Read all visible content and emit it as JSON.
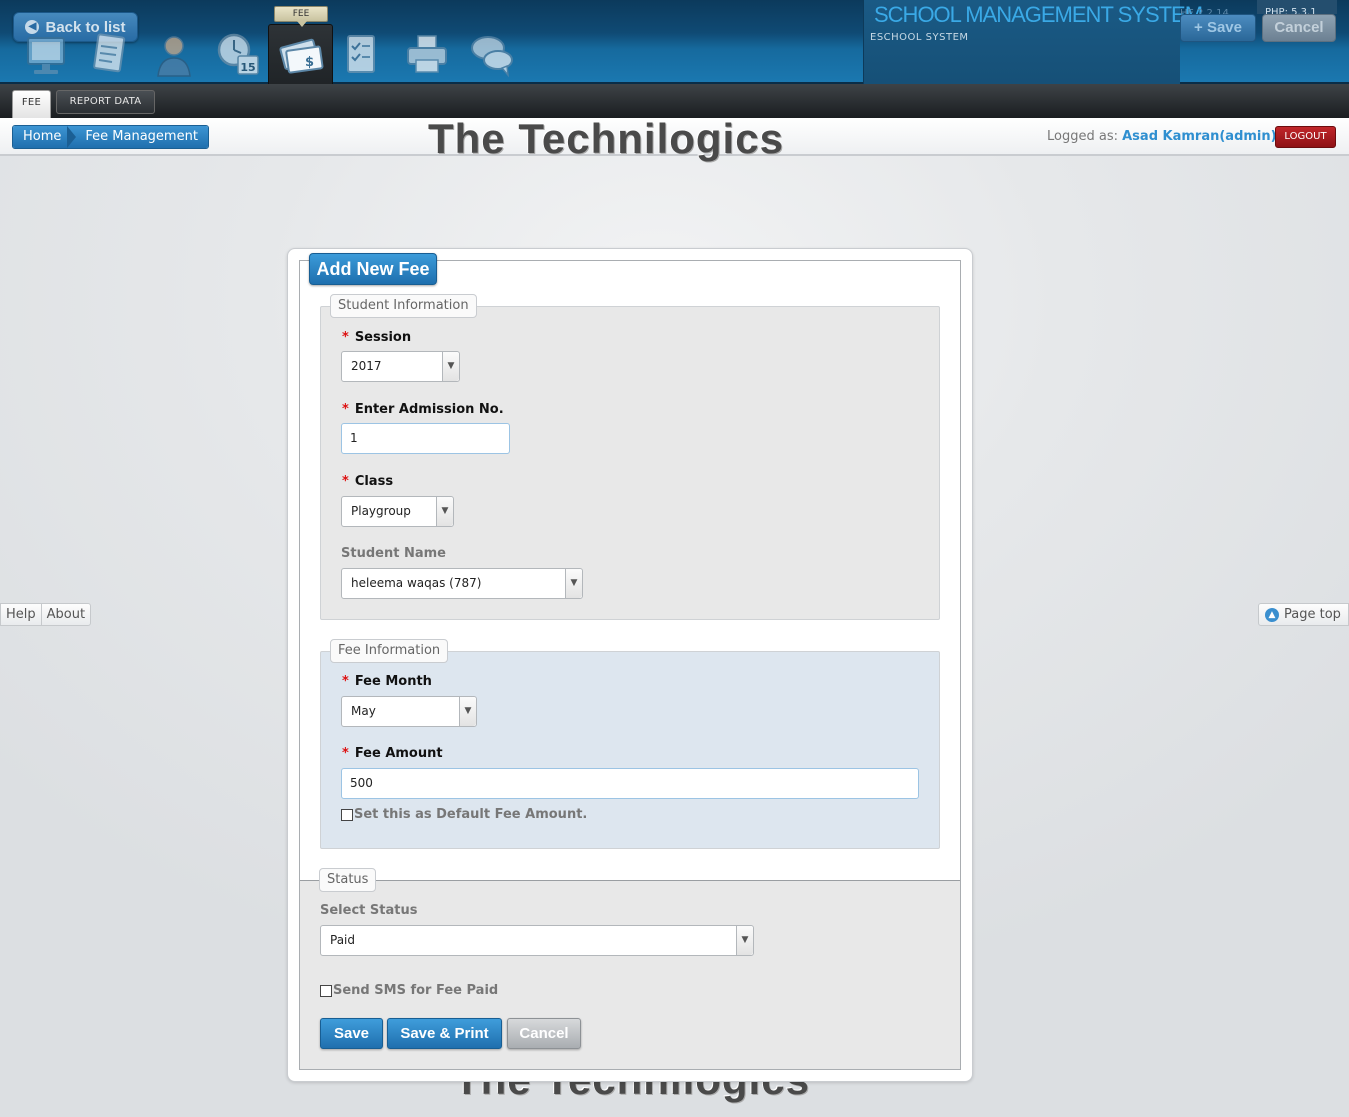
{
  "toolbar": {
    "back_label": "Back to list",
    "active_module_flag": "FEE",
    "brand_title": "SCHOOL MANAGEMENT SYSTEM",
    "brand_subtitle": "ESCHOOL SYSTEM",
    "version_text": "HE 2.2.14",
    "php_label": "PHP: 5.3.1",
    "save_label": "+ Save",
    "cancel_label": "Cancel",
    "module_icons": [
      "monitor-icon",
      "notepad-icon",
      "user-icon",
      "calendar-clock-icon",
      "fee-icon",
      "checklist-icon",
      "printer-icon",
      "chat-icon"
    ]
  },
  "tabs": [
    {
      "label": "FEE",
      "active": true
    },
    {
      "label": "REPORT DATA",
      "active": false
    }
  ],
  "breadcrumb": {
    "home": "Home",
    "current": "Fee Management"
  },
  "user": {
    "logged_prefix": "Logged as:",
    "name": "Asad Kamran(admin)",
    "logout_label": "LOGOUT"
  },
  "watermark": "The Technilogics",
  "side": {
    "help": "Help",
    "about": "About",
    "page_top": "Page top"
  },
  "form": {
    "title": "Add New Fee",
    "student_section": {
      "legend": "Student Information",
      "session_label": "Session",
      "session_value": "2017",
      "admission_label": "Enter Admission No.",
      "admission_value": "1",
      "class_label": "Class",
      "class_value": "Playgroup",
      "student_label": "Student Name",
      "student_value": "heleema waqas (787)"
    },
    "fee_section": {
      "legend": "Fee Information",
      "month_label": "Fee Month",
      "month_value": "May",
      "amount_label": "Fee Amount",
      "amount_value": "500",
      "default_label": "Set this as Default Fee Amount."
    },
    "status_section": {
      "legend": "Status",
      "select_label": "Select Status",
      "status_value": "Paid",
      "sms_label": "Send SMS for Fee Paid"
    },
    "buttons": {
      "save": "Save",
      "save_print": "Save & Print",
      "cancel": "Cancel"
    }
  },
  "colors": {
    "primary_blue": "#1f6fae",
    "header_dark": "#0f4a74",
    "logout_red": "#a31a1d",
    "required_star": "#d11111"
  }
}
